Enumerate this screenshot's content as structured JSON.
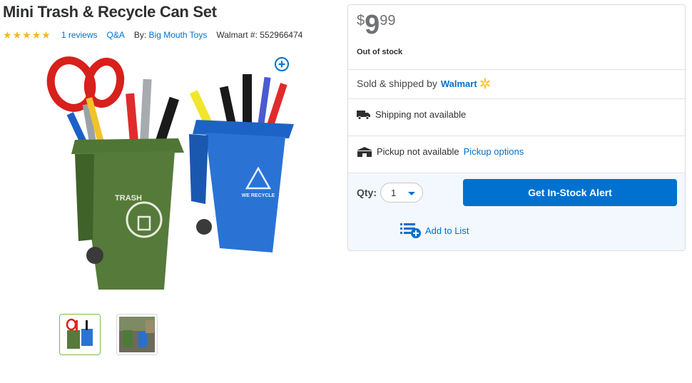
{
  "product": {
    "title": "Mini Trash & Recycle Can Set",
    "rating": 5,
    "reviews_label": "1 reviews",
    "qa_label": "Q&A",
    "by_prefix": "By:",
    "brand": "Big Mouth Toys",
    "item_number_label": "Walmart #: 552966474",
    "image_labels": {
      "trash": "TRASH",
      "recycle": "WE RECYCLE"
    }
  },
  "offer": {
    "currency": "$",
    "price_whole": "9",
    "price_fraction": "99",
    "stock_status": "Out of stock",
    "sold_by_prefix": "Sold & shipped by",
    "seller": "Walmart",
    "shipping_status": "Shipping not available",
    "pickup_status": "Pickup not available",
    "pickup_link": "Pickup options",
    "qty_label": "Qty:",
    "qty_value": "1",
    "alert_button": "Get In-Stock Alert",
    "add_to_list": "Add to List"
  },
  "colors": {
    "accent_blue": "#0071ce",
    "star_yellow": "#f6b718",
    "spark_yellow": "#ffc220",
    "selected_thumb_border": "#76c043"
  },
  "icons": [
    "star-icon",
    "zoom-plus-icon",
    "walmart-spark-icon",
    "truck-icon",
    "store-icon",
    "caret-down-icon",
    "add-to-list-icon"
  ]
}
